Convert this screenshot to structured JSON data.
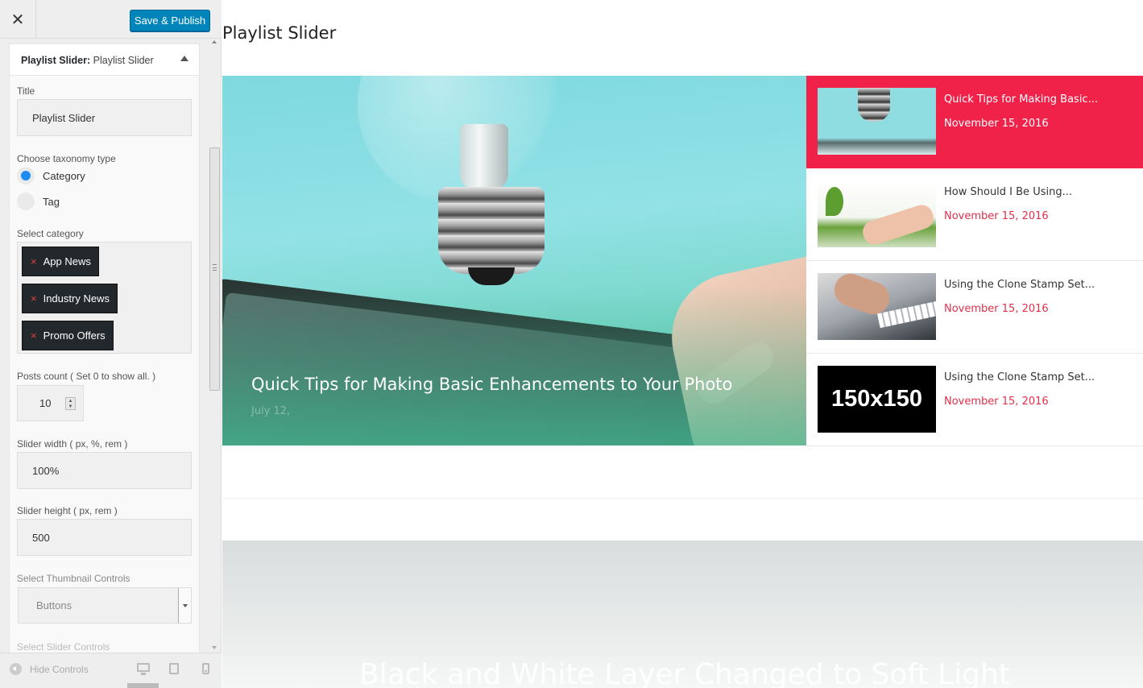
{
  "topbar": {
    "close_icon": "close-icon",
    "publish_label": "Save & Publish"
  },
  "panel": {
    "header_strong": "Playlist Slider:",
    "header_name": "Playlist Slider",
    "title_label": "Title",
    "title_value": "Playlist Slider",
    "taxonomy_label": "Choose taxonomy type",
    "taxonomy_options": [
      {
        "label": "Category",
        "selected": true
      },
      {
        "label": "Tag",
        "selected": false
      }
    ],
    "category_label": "Select category",
    "categories": [
      {
        "remove": "×",
        "label": "App News"
      },
      {
        "remove": "×",
        "label": "Industry News"
      },
      {
        "remove": "×",
        "label": "Promo Offers"
      }
    ],
    "posts_count_label": "Posts count ( Set 0 to show all. )",
    "posts_count_value": "10",
    "slider_width_label": "Slider width ( px, %, rem )",
    "slider_width_value": "100%",
    "slider_height_label": "Slider height ( px, rem )",
    "slider_height_value": "500",
    "thumb_controls_label": "Select Thumbnail Controls",
    "thumb_controls_value": "Buttons",
    "slider_controls_label": "Select Slider Controls"
  },
  "footer": {
    "hide_controls_label": "Hide Controls"
  },
  "preview": {
    "widget_title": "Playlist Slider",
    "featured": {
      "title": "Quick Tips for Making Basic Enhancements to Your Photo",
      "date": "July 12,"
    },
    "items": [
      {
        "title": "Quick Tips for Making Basic...",
        "date": "November 15, 2016",
        "active": true
      },
      {
        "title": "How Should I Be Using...",
        "date": "November 15, 2016",
        "active": false
      },
      {
        "title": "Using the Clone Stamp Set...",
        "date": "November 15, 2016",
        "active": false
      },
      {
        "title": "Using the Clone Stamp Set...",
        "date": "November 15, 2016",
        "active": false,
        "thumb_text": "150x150"
      }
    ],
    "next_title": "Black and White Layer Changed to Soft Light"
  },
  "colors": {
    "accent": "#f0224a",
    "publish": "#0085ba",
    "radio": "#1e8cf0"
  }
}
